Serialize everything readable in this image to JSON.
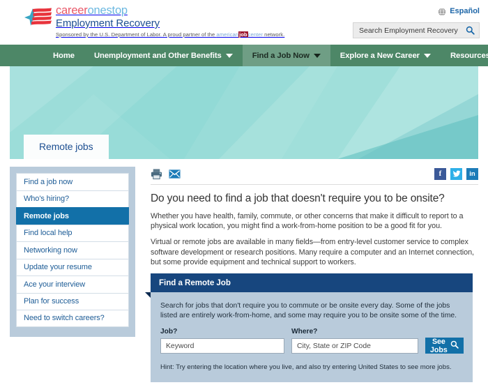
{
  "header": {
    "brand_career": "career",
    "brand_onestop": "onestop",
    "brand_subtitle": "Employment Recovery",
    "tagline_before": "Sponsored by the U.S. Department of Labor. A proud partner of the ",
    "ajc_american": "american",
    "ajc_job": "job",
    "ajc_center": "center",
    "tagline_after": " network.",
    "language_link": "Español",
    "globe_icon": "globe-icon",
    "search_placeholder": "Search Employment Recovery",
    "search_value": "",
    "search_icon": "magnifier-icon"
  },
  "nav": {
    "items": [
      {
        "label": "Home",
        "has_caret": false,
        "active": false
      },
      {
        "label": "Unemployment and Other Benefits",
        "has_caret": true,
        "active": false
      },
      {
        "label": "Find a Job Now",
        "has_caret": true,
        "active": true
      },
      {
        "label": "Explore a New Career",
        "has_caret": true,
        "active": false
      },
      {
        "label": "Resources For",
        "has_caret": true,
        "active": false
      }
    ]
  },
  "hero": {
    "tab_label": "Remote jobs"
  },
  "sidebar": {
    "items": [
      {
        "label": "Find a job now",
        "active": false
      },
      {
        "label": "Who's hiring?",
        "active": false
      },
      {
        "label": "Remote jobs",
        "active": true
      },
      {
        "label": "Find local help",
        "active": false
      },
      {
        "label": "Networking now",
        "active": false
      },
      {
        "label": "Update your resume",
        "active": false
      },
      {
        "label": "Ace your interview",
        "active": false
      },
      {
        "label": "Plan for success",
        "active": false
      },
      {
        "label": "Need to switch careers?",
        "active": false
      }
    ]
  },
  "utility": {
    "print_icon": "printer-icon",
    "email_icon": "envelope-icon",
    "facebook_label": "f",
    "twitter_icon": "twitter-bird-icon",
    "linkedin_label": "in"
  },
  "main": {
    "title": "Do you need to find a job that doesn't require you to be onsite?",
    "paragraph1": "Whether you have health, family, commute, or other concerns that make it difficult to report to a physical work location, you might find a work-from-home position to be a good fit for you.",
    "paragraph2": "Virtual or remote jobs are available in many fields—from entry-level customer service to complex software development or research positions. Many require a computer and an Internet connection, but some provide equipment and technical support to workers."
  },
  "search_panel": {
    "heading": "Find a Remote Job",
    "description": "Search for jobs that don't require you to commute or be onsite every day. Some of the jobs listed are entirely work-from-home, and some may require you to be onsite some of the time.",
    "job_label": "Job?",
    "job_placeholder": "Keyword",
    "job_value": "",
    "where_label": "Where?",
    "where_placeholder": "City, State or ZIP Code",
    "where_value": "",
    "submit_label": "See Jobs",
    "submit_icon": "magnifier-icon",
    "hint": "Hint: Try entering the location where you live, and also try entering United States to see more jobs."
  },
  "colors": {
    "nav_green": "#4d8767",
    "nav_active_green": "#6f9e85",
    "panel_blue": "#17467e",
    "accent_blue": "#1270a8",
    "sidebar_bg": "#b9cbdb",
    "hero_teal": "#8bd5d2",
    "brand_red": "#e8596a",
    "brand_lightblue": "#6cb8e0",
    "brand_navy": "#1d4f91"
  }
}
